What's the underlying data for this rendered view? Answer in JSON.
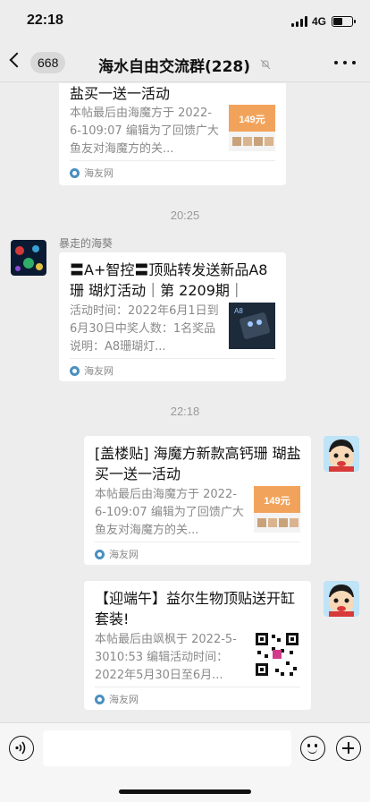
{
  "status_bar": {
    "time": "22:18",
    "network": "4G",
    "battery_level": 0.55
  },
  "nav": {
    "back_count": "668",
    "title": "海水自由交流群(228)"
  },
  "messages": [
    {
      "title": "盐买一送一活动",
      "desc": "本帖最后由海魔方于 2022-6-109:07 编辑为了回馈广大鱼友对海魔方的关...",
      "thumb_text": "149元",
      "source": "海友网"
    },
    {
      "timestamp": "20:25",
      "sender": "暴走的海葵",
      "title": "〓A+智控〓顶贴转发送新品A8珊 瑚灯活动｜第 2209期｜",
      "desc": "活动时间：2022年6月1日到6月30日中奖人数：1名奖品说明：A8珊瑚灯...",
      "thumb_text": "A8",
      "source": "海友网"
    },
    {
      "timestamp": "22:18",
      "title": "[盖楼贴] 海魔方新款高钙珊 瑚盐买一送一活动",
      "desc": "本帖最后由海魔方于 2022-6-109:07 编辑为了回馈广大鱼友对海魔方的关...",
      "thumb_text": "149元",
      "source": "海友网"
    },
    {
      "title": "【迎端午】益尔生物顶贴送开缸套装!",
      "desc": "本帖最后由飒枫于 2022-5-3010:53 编辑活动时间：2022年5月30日至6月...",
      "source": "海友网"
    }
  ],
  "colors": {
    "background": "#ededed",
    "card": "#ffffff",
    "accent": "#f2a35b"
  }
}
